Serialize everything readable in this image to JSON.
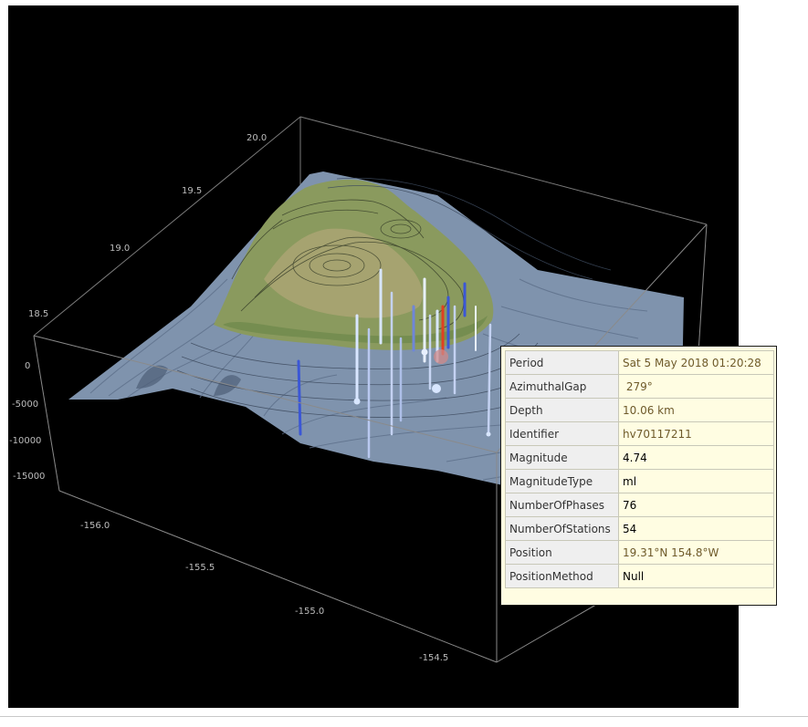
{
  "axes": {
    "latitude_ticks": [
      "20.0",
      "19.5",
      "19.0",
      "18.5"
    ],
    "depth_ticks": [
      "0",
      "-5000",
      "-10000",
      "-15000"
    ],
    "longitude_ticks": [
      "-156.0",
      "-155.5",
      "-155.0",
      "-154.5"
    ]
  },
  "colors": {
    "background": "#000000",
    "ocean": "#7f93ad",
    "land": "#8a9a5e",
    "quake_highlight": "#e04020",
    "quake_pale": "#d8e6ff",
    "quake_blue": "#3b57d6"
  },
  "tooltip": {
    "rows": [
      {
        "key": "Period",
        "value": "Sat 5 May 2018 01:20:28",
        "tint": true
      },
      {
        "key": "AzimuthalGap",
        "value": " 279°",
        "tint": true
      },
      {
        "key": "Depth",
        "value": "10.06 km",
        "tint": true
      },
      {
        "key": "Identifier",
        "value": "hv70117211",
        "tint": true
      },
      {
        "key": "Magnitude",
        "value": "4.74",
        "tint": false
      },
      {
        "key": "MagnitudeType",
        "value": "ml",
        "tint": false
      },
      {
        "key": "NumberOfPhases",
        "value": "76",
        "tint": false
      },
      {
        "key": "NumberOfStations",
        "value": "54",
        "tint": false
      },
      {
        "key": "Position",
        "value": "19.31°N 154.8°W",
        "tint": true
      },
      {
        "key": "PositionMethod",
        "value": "Null",
        "tint": false
      }
    ]
  }
}
